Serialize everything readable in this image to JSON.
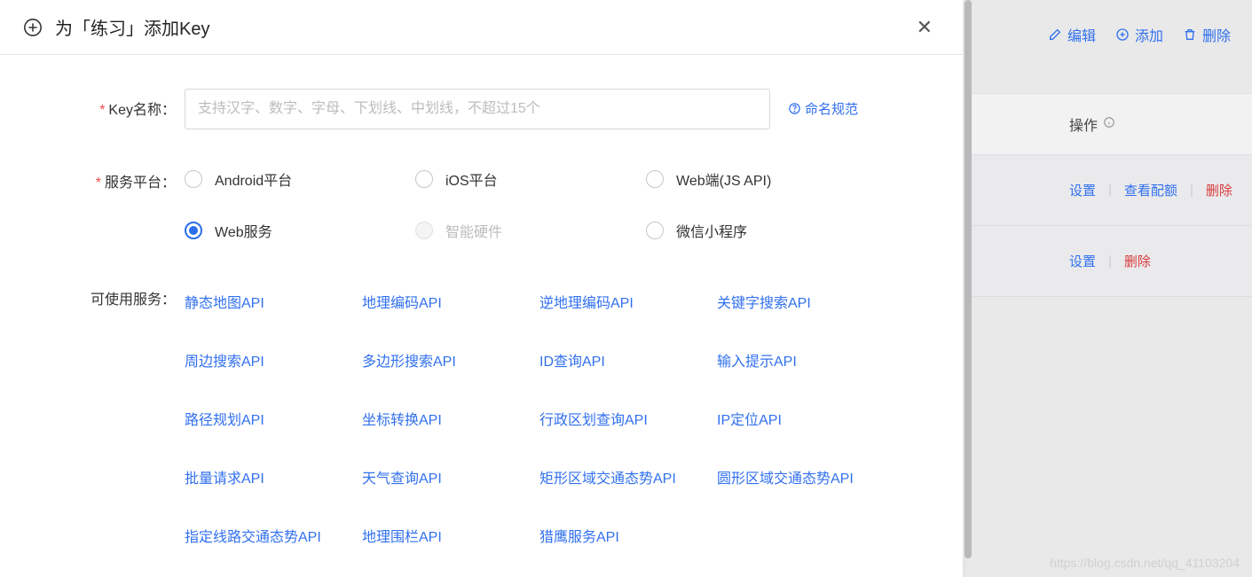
{
  "modal": {
    "title": "为「练习」添加Key",
    "fields": {
      "name_label": "Key名称：",
      "name_placeholder": "支持汉字、数字、字母、下划线、中划线，不超过15个",
      "naming_guide": "命名规范",
      "platform_label": "服务平台：",
      "platforms": [
        {
          "label": "Android平台",
          "state": "normal"
        },
        {
          "label": "iOS平台",
          "state": "normal"
        },
        {
          "label": "Web端(JS API)",
          "state": "normal"
        },
        {
          "label": "Web服务",
          "state": "selected"
        },
        {
          "label": "智能硬件",
          "state": "disabled"
        },
        {
          "label": "微信小程序",
          "state": "normal"
        }
      ],
      "services_label": "可使用服务：",
      "services": [
        "静态地图API",
        "地理编码API",
        "逆地理编码API",
        "关键字搜索API",
        "周边搜索API",
        "多边形搜索API",
        "ID查询API",
        "输入提示API",
        "路径规划API",
        "坐标转换API",
        "行政区划查询API",
        "IP定位API",
        "批量请求API",
        "天气查询API",
        "矩形区域交通态势API",
        "圆形区域交通态势API",
        "指定线路交通态势API",
        "地理围栏API",
        "猎鹰服务API"
      ]
    }
  },
  "background": {
    "topbar": {
      "edit": "编辑",
      "add": "添加",
      "delete": "删除"
    },
    "table_header": "操作",
    "row1": {
      "a": "设置",
      "b": "查看配额",
      "c": "删除"
    },
    "row2": {
      "a": "设置",
      "b": "删除"
    },
    "watermark": "https://blog.csdn.net/qq_41103204"
  }
}
